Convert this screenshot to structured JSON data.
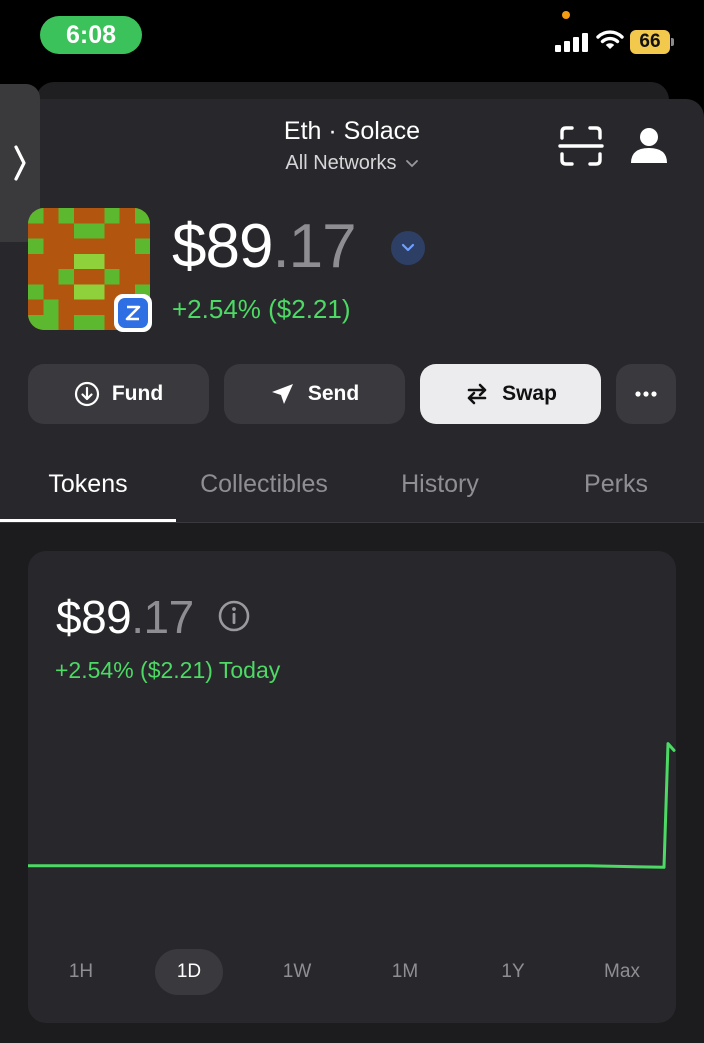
{
  "status_bar": {
    "time": "6:08",
    "battery": "66"
  },
  "header": {
    "wallet_title": "Eth · Solace",
    "network_label": "All Networks"
  },
  "balance": {
    "dollars": "$89",
    "cents": ".17",
    "change": "+2.54% ($2.21)"
  },
  "actions": [
    {
      "label": "Fund",
      "icon": "fund-icon"
    },
    {
      "label": "Send",
      "icon": "send-icon"
    },
    {
      "label": "Swap",
      "icon": "swap-icon"
    },
    {
      "label": "",
      "icon": "more-icon"
    }
  ],
  "tabs": [
    {
      "label": "Tokens",
      "active": true
    },
    {
      "label": "Collectibles",
      "active": false
    },
    {
      "label": "History",
      "active": false
    },
    {
      "label": "Perks",
      "active": false
    }
  ],
  "chart_card": {
    "dollars": "$89",
    "cents": ".17",
    "change": "+2.54% ($2.21) Today",
    "ranges": [
      "1H",
      "1D",
      "1W",
      "1M",
      "1Y",
      "Max"
    ],
    "selected_range": "1D"
  },
  "chart_data": {
    "type": "line",
    "series": [
      {
        "values": [
          86.96,
          86.96,
          86.96,
          86.96,
          86.96,
          86.96,
          86.96,
          86.96,
          86.96,
          86.96,
          86.93,
          89.3,
          89.17
        ]
      }
    ],
    "title": "",
    "xlabel": "",
    "ylabel": "",
    "grid": false
  },
  "colors": {
    "accent_green": "#4cd964",
    "background": "#28282c",
    "status_pill": "#3bc25a",
    "battery": "#f2c94c",
    "badge_blue": "#2f6fe4"
  }
}
